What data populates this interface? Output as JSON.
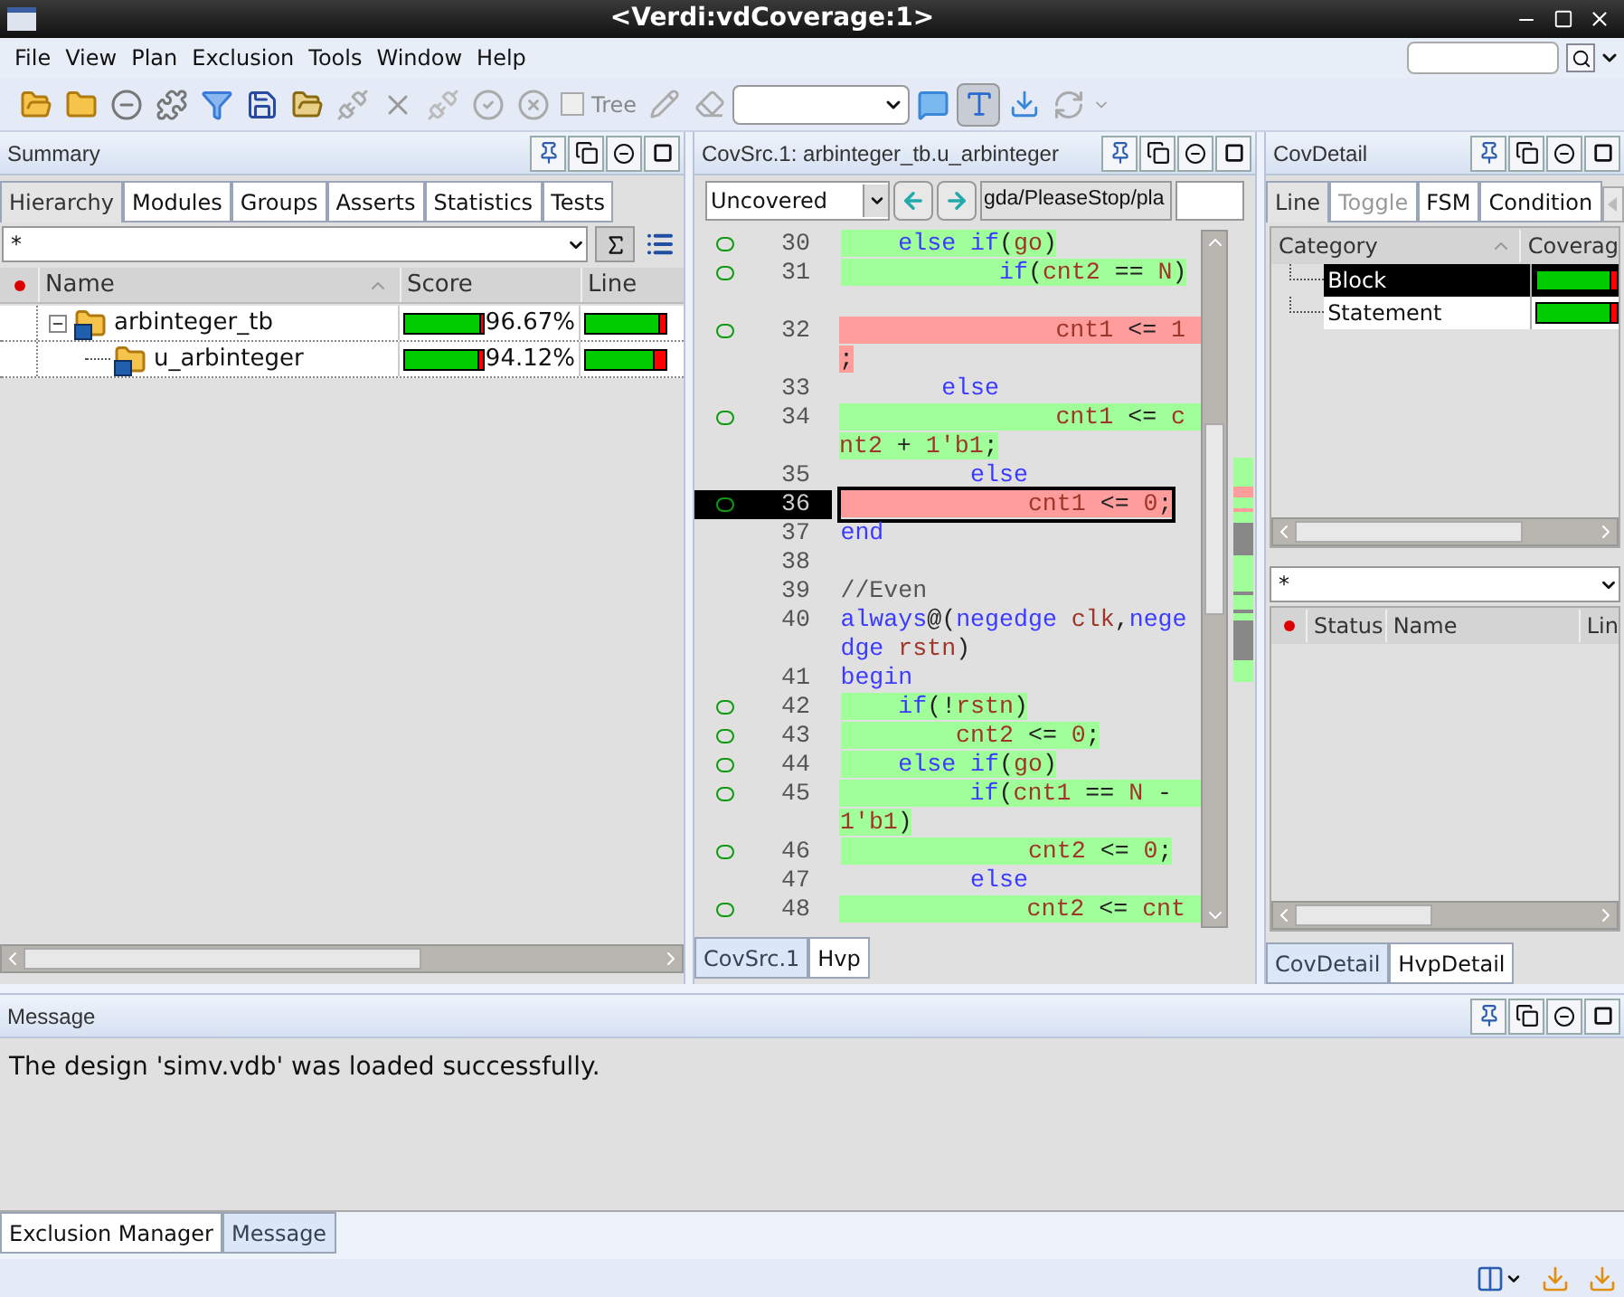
{
  "window": {
    "title": "<Verdi:vdCoverage:1>"
  },
  "menu": [
    "File",
    "View",
    "Plan",
    "Exclusion",
    "Tools",
    "Window",
    "Help"
  ],
  "toolbar": {
    "tree_checkbox": {
      "label": "Tree",
      "checked": false
    }
  },
  "summary": {
    "title": "Summary",
    "tabs": [
      {
        "label": "Hierarchy",
        "selected": true
      },
      {
        "label": "Modules",
        "selected": false
      },
      {
        "label": "Groups",
        "selected": false
      },
      {
        "label": "Asserts",
        "selected": false
      },
      {
        "label": "Statistics",
        "selected": false
      },
      {
        "label": "Tests",
        "selected": false
      }
    ],
    "filter": "*",
    "columns": [
      "Name",
      "Score",
      "Line"
    ],
    "rows": [
      {
        "name": "arbinteger_tb",
        "expanded": true,
        "score": {
          "level": 0.9667,
          "reading": "96.67%"
        },
        "line": {
          "level": 0.93
        },
        "children": [
          {
            "name": "u_arbinteger",
            "score": {
              "level": 0.9412,
              "reading": "94.12%"
            },
            "line": {
              "level": 0.87
            }
          }
        ]
      }
    ]
  },
  "source": {
    "title": "CovSrc.1: arbinteger_tb.u_arbinteger",
    "mode": "Uncovered",
    "path": "gda/PleaseStop/pla",
    "lines": [
      {
        "number": "30",
        "marker": true,
        "kind": "covered",
        "selected": false,
        "rows": [
          {
            "kind": "code",
            "segments": [
              {
                "text": "    else",
                "kind": "keyword"
              },
              {
                "text": " if",
                "kind": "keyword"
              },
              {
                "text": "(",
                "kind": "plain"
              },
              {
                "text": "go",
                "kind": "identifier"
              },
              {
                "text": ")",
                "kind": "plain"
              }
            ]
          }
        ]
      },
      {
        "number": "31",
        "marker": true,
        "kind": "covered",
        "selected": false,
        "rows": [
          {
            "kind": "code",
            "segments": [
              {
                "text": "           if",
                "kind": "keyword"
              },
              {
                "text": "(",
                "kind": "plain"
              },
              {
                "text": "cnt2",
                "kind": "identifier"
              },
              {
                "text": " == ",
                "kind": "plain"
              },
              {
                "text": "N",
                "kind": "identifier"
              },
              {
                "text": ")",
                "kind": "plain"
              }
            ]
          },
          {
            "kind": "blank"
          }
        ]
      },
      {
        "number": "32",
        "marker": true,
        "kind": "uncovered",
        "selected": false,
        "rows": [
          {
            "kind": "code",
            "segments": [
              {
                "text": "               cnt1",
                "kind": "identifier"
              },
              {
                "text": " <= ",
                "kind": "plain"
              },
              {
                "text": "1  ",
                "kind": "identifier"
              }
            ]
          },
          {
            "kind": "code",
            "segments": [
              {
                "text": ";",
                "kind": "plain"
              }
            ]
          }
        ]
      },
      {
        "number": "33",
        "marker": false,
        "kind": "plain",
        "selected": false,
        "rows": [
          {
            "kind": "code",
            "segments": [
              {
                "text": "       else",
                "kind": "keyword"
              }
            ]
          }
        ]
      },
      {
        "number": "34",
        "marker": true,
        "kind": "covered",
        "selected": false,
        "rows": [
          {
            "kind": "code",
            "segments": [
              {
                "text": "               cnt1",
                "kind": "identifier"
              },
              {
                "text": " <= ",
                "kind": "plain"
              },
              {
                "text": "c  ",
                "kind": "identifier"
              }
            ]
          },
          {
            "kind": "code",
            "segments": [
              {
                "text": "nt2",
                "kind": "identifier"
              },
              {
                "text": " + ",
                "kind": "plain"
              },
              {
                "text": "1'b1",
                "kind": "identifier"
              },
              {
                "text": ";",
                "kind": "plain"
              }
            ]
          }
        ]
      },
      {
        "number": "35",
        "marker": false,
        "kind": "plain",
        "selected": false,
        "rows": [
          {
            "kind": "code",
            "segments": [
              {
                "text": "         else",
                "kind": "keyword"
              }
            ]
          }
        ]
      },
      {
        "number": "36",
        "marker": true,
        "kind": "uncovered",
        "selected": true,
        "rows": [
          {
            "kind": "code",
            "segments": [
              {
                "text": "             cnt1",
                "kind": "identifier"
              },
              {
                "text": " <= ",
                "kind": "plain"
              },
              {
                "text": "0",
                "kind": "identifier"
              },
              {
                "text": ";",
                "kind": "plain"
              }
            ]
          }
        ]
      },
      {
        "number": "37",
        "marker": false,
        "kind": "plain",
        "selected": false,
        "rows": [
          {
            "kind": "code",
            "segments": [
              {
                "text": "end",
                "kind": "keyword"
              }
            ]
          }
        ]
      },
      {
        "number": "38",
        "marker": false,
        "selected": false,
        "rows": [
          {
            "kind": "blank"
          }
        ]
      },
      {
        "number": "39",
        "marker": false,
        "kind": "plain",
        "selected": false,
        "rows": [
          {
            "kind": "code",
            "segments": [
              {
                "text": "//Even",
                "kind": "comment"
              }
            ]
          }
        ]
      },
      {
        "number": "40",
        "marker": false,
        "kind": "plain",
        "selected": false,
        "rows": [
          {
            "kind": "code",
            "segments": [
              {
                "text": "always",
                "kind": "keyword"
              },
              {
                "text": "@(",
                "kind": "plain"
              },
              {
                "text": "negedge",
                "kind": "keyword"
              },
              {
                "text": " clk",
                "kind": "identifier"
              },
              {
                "text": ",",
                "kind": "plain"
              },
              {
                "text": "nege",
                "kind": "keyword"
              }
            ]
          },
          {
            "kind": "code",
            "segments": [
              {
                "text": "dge",
                "kind": "keyword"
              },
              {
                "text": " rstn",
                "kind": "identifier"
              },
              {
                "text": ")",
                "kind": "plain"
              }
            ]
          }
        ]
      },
      {
        "number": "41",
        "marker": false,
        "kind": "plain",
        "selected": false,
        "rows": [
          {
            "kind": "code",
            "segments": [
              {
                "text": "begin",
                "kind": "keyword"
              }
            ]
          }
        ]
      },
      {
        "number": "42",
        "marker": true,
        "kind": "covered",
        "selected": false,
        "rows": [
          {
            "kind": "code",
            "segments": [
              {
                "text": "    if",
                "kind": "keyword"
              },
              {
                "text": "(!",
                "kind": "plain"
              },
              {
                "text": "rstn",
                "kind": "identifier"
              },
              {
                "text": ")",
                "kind": "plain"
              }
            ]
          }
        ]
      },
      {
        "number": "43",
        "marker": true,
        "kind": "covered",
        "selected": false,
        "rows": [
          {
            "kind": "code",
            "segments": [
              {
                "text": "        cnt2",
                "kind": "identifier"
              },
              {
                "text": " <= ",
                "kind": "plain"
              },
              {
                "text": "0",
                "kind": "identifier"
              },
              {
                "text": ";",
                "kind": "plain"
              }
            ]
          }
        ]
      },
      {
        "number": "44",
        "marker": true,
        "kind": "covered",
        "selected": false,
        "rows": [
          {
            "kind": "code",
            "segments": [
              {
                "text": "    else",
                "kind": "keyword"
              },
              {
                "text": " if",
                "kind": "keyword"
              },
              {
                "text": "(",
                "kind": "plain"
              },
              {
                "text": "go",
                "kind": "identifier"
              },
              {
                "text": ")",
                "kind": "plain"
              }
            ]
          }
        ]
      },
      {
        "number": "45",
        "marker": true,
        "kind": "covered",
        "selected": false,
        "rows": [
          {
            "kind": "code",
            "segments": [
              {
                "text": "         if",
                "kind": "keyword"
              },
              {
                "text": "(",
                "kind": "plain"
              },
              {
                "text": "cnt1",
                "kind": "identifier"
              },
              {
                "text": " == ",
                "kind": "plain"
              },
              {
                "text": "N",
                "kind": "identifier"
              },
              {
                "text": " -  ",
                "kind": "plain"
              }
            ]
          },
          {
            "kind": "code",
            "segments": [
              {
                "text": "1'b1",
                "kind": "identifier"
              },
              {
                "text": ")",
                "kind": "plain"
              }
            ]
          }
        ]
      },
      {
        "number": "46",
        "marker": true,
        "kind": "covered",
        "selected": false,
        "rows": [
          {
            "kind": "code",
            "segments": [
              {
                "text": "             cnt2",
                "kind": "identifier"
              },
              {
                "text": " <= ",
                "kind": "plain"
              },
              {
                "text": "0",
                "kind": "identifier"
              },
              {
                "text": ";",
                "kind": "plain"
              }
            ]
          }
        ]
      },
      {
        "number": "47",
        "marker": false,
        "kind": "plain",
        "selected": false,
        "rows": [
          {
            "kind": "code",
            "segments": [
              {
                "text": "         else",
                "kind": "keyword"
              }
            ]
          }
        ]
      },
      {
        "number": "48",
        "marker": true,
        "kind": "covered",
        "selected": false,
        "rows": [
          {
            "kind": "code",
            "segments": [
              {
                "text": "             cnt2",
                "kind": "identifier"
              },
              {
                "text": " <= ",
                "kind": "plain"
              },
              {
                "text": "cnt  ",
                "kind": "identifier"
              }
            ]
          }
        ]
      }
    ],
    "bottom_tabs": [
      {
        "label": "CovSrc.1",
        "selected": true
      },
      {
        "label": "Hvp",
        "selected": false
      }
    ]
  },
  "detail": {
    "title": "CovDetail",
    "tabs": [
      {
        "label": "Line",
        "selected": true,
        "disabled": false
      },
      {
        "label": "Toggle",
        "selected": false,
        "disabled": true
      },
      {
        "label": "FSM",
        "selected": false,
        "disabled": false
      },
      {
        "label": "Condition",
        "selected": false,
        "disabled": false
      }
    ],
    "columns": [
      "Category",
      "Coverag"
    ],
    "rows": [
      {
        "name": "Block",
        "selected": true,
        "coverage": {
          "level": 0.93
        }
      },
      {
        "name": "Statement",
        "selected": false,
        "coverage": {
          "level": 0.93
        }
      }
    ],
    "filter": "*",
    "list_columns": [
      "Status",
      "Name",
      "Lin"
    ],
    "bottom_tabs": [
      {
        "label": "CovDetail",
        "selected": true
      },
      {
        "label": "HvpDetail",
        "selected": false
      }
    ]
  },
  "message": {
    "title": "Message",
    "text": "The design 'simv.vdb' was loaded successfully."
  },
  "bottom_tabs": [
    {
      "label": "Exclusion Manager",
      "selected": false
    },
    {
      "label": "Message",
      "selected": true
    }
  ]
}
